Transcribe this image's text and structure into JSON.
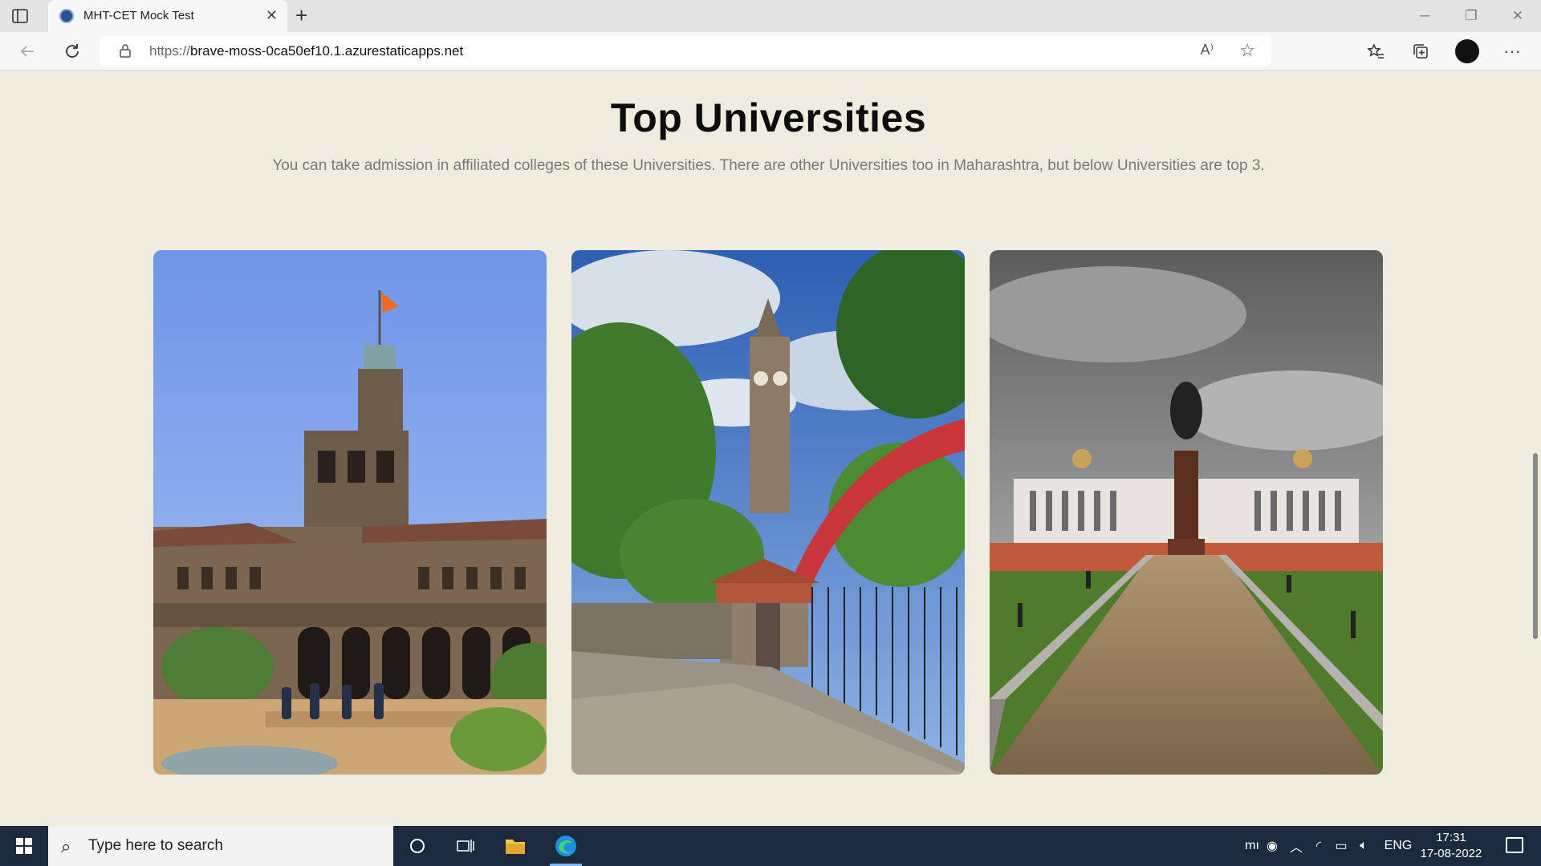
{
  "browser": {
    "tab_title": "MHT-CET Mock Test",
    "tab_close": "✕",
    "new_tab": "+",
    "url_prefix": "https://",
    "url_host": "brave-moss-0ca50ef10.1.azurestaticapps.net",
    "read_aloud_icon": "A⁾",
    "window_minimize": "─",
    "window_restore": "❐",
    "window_close": "✕"
  },
  "page": {
    "title": "Top Universities",
    "subtitle": "You can take admission in affiliated colleges of these Universities. There are other Universities too in Maharashtra, but below Universities are top 3."
  },
  "taskbar": {
    "search_placeholder": "Type here to search",
    "language": "ENG",
    "time": "17:31",
    "date": "17-08-2022"
  }
}
